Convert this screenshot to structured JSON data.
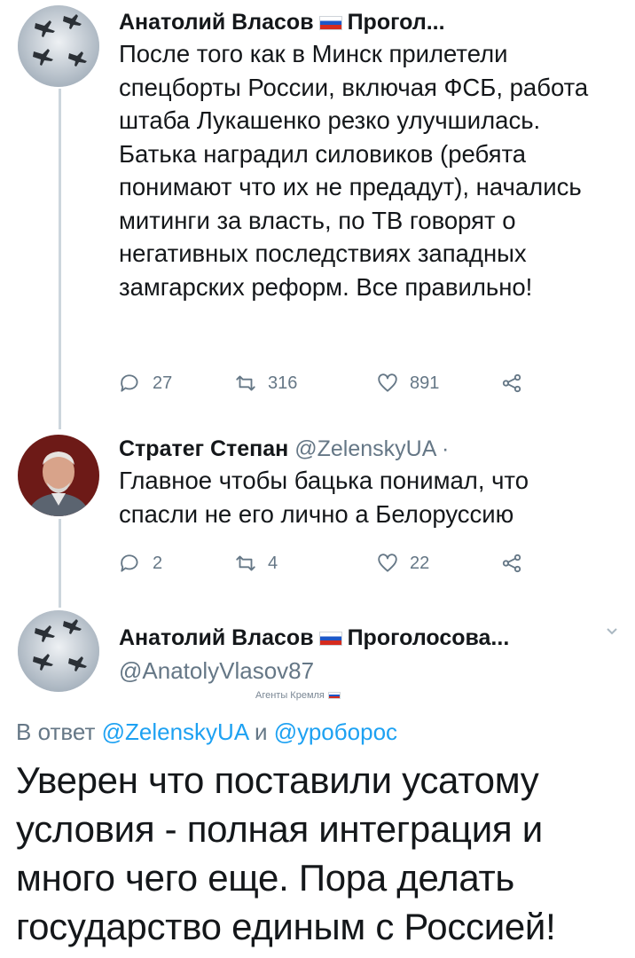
{
  "tweet1": {
    "name": "Анатолий Власов",
    "name_suffix": "Прогол...",
    "text": "После того как в Минск прилетели спецборты России, включая ФСБ, работа штаба Лукашенко резко улучшилась. Батька наградил силовиков (ребята понимают что их не предадут), начались митинги за власть, по ТВ говорят о негативных последствиях западных замгарских реформ. Все правильно!",
    "replies": "27",
    "retweets": "316",
    "likes": "891"
  },
  "tweet2": {
    "name": "Стратег Степан",
    "handle": "@ZelenskyUA",
    "separator": "·",
    "text": "Главное чтобы бацька понимал, что спасли не его лично а Белоруссию",
    "replies": "2",
    "retweets": "4",
    "likes": "22"
  },
  "main": {
    "name": "Анатолий Власов",
    "name_suffix": "Проголосова...",
    "handle": "@AnatolyVlasov87",
    "watermark": "Агенты Кремля",
    "reply_prefix": "В ответ",
    "reply_user1": "@ZelenskyUA",
    "reply_and": "и",
    "reply_user2": "@уроборос",
    "text": "Уверен что поставили усатому условия - полная интеграция и много чего еще. Пора делать государство единым с Россией!"
  },
  "icons": [
    "reply-icon",
    "retweet-icon",
    "like-icon",
    "share-icon",
    "chevron-down-icon"
  ],
  "colors": {
    "link": "#1da1f2",
    "muted": "#657786",
    "thread": "#ccd6dd"
  }
}
